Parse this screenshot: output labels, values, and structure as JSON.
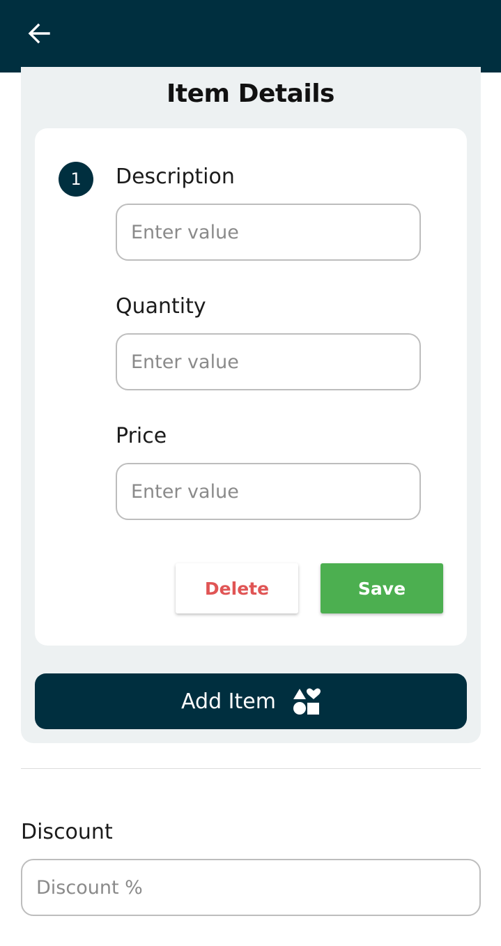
{
  "header": {
    "back_icon": "arrow-left-icon",
    "background_color": "#002f3f"
  },
  "item_details": {
    "title": "Item Details",
    "step_number": "1",
    "fields": [
      {
        "label": "Description",
        "placeholder": "Enter value",
        "value": ""
      },
      {
        "label": "Quantity",
        "placeholder": "Enter value",
        "value": ""
      },
      {
        "label": "Price",
        "placeholder": "Enter value",
        "value": ""
      }
    ],
    "delete_label": "Delete",
    "save_label": "Save",
    "delete_color": "#e05555",
    "save_color": "#4caf50"
  },
  "add_item": {
    "label": "Add Item",
    "icon": "shapes-icon"
  },
  "discount": {
    "label": "Discount",
    "placeholder": "Discount %",
    "value": ""
  }
}
